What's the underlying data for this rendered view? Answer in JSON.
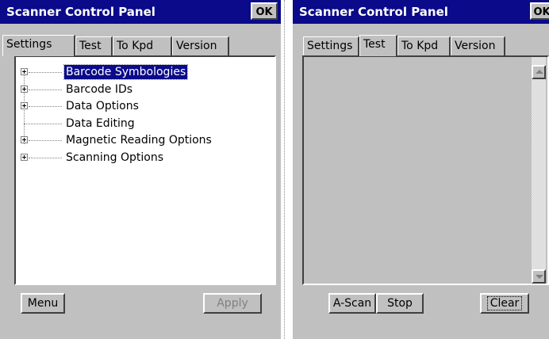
{
  "left": {
    "title": "Scanner Control Panel",
    "ok_label": "OK",
    "tabs": [
      {
        "label": "Settings",
        "active": true
      },
      {
        "label": "Test",
        "active": false
      },
      {
        "label": "To Kpd",
        "active": false
      },
      {
        "label": "Version",
        "active": false
      }
    ],
    "tree": [
      {
        "label": "Barcode Symbologies",
        "expandable": true,
        "selected": true,
        "icon": "expand-plus-icon"
      },
      {
        "label": "Barcode IDs",
        "expandable": true,
        "selected": false,
        "icon": "expand-plus-icon"
      },
      {
        "label": "Data Options",
        "expandable": true,
        "selected": false,
        "icon": "expand-plus-icon"
      },
      {
        "label": "Data Editing",
        "expandable": false,
        "selected": false
      },
      {
        "label": "Magnetic Reading Options",
        "expandable": true,
        "selected": false,
        "icon": "expand-plus-icon"
      },
      {
        "label": "Scanning Options",
        "expandable": true,
        "selected": false,
        "icon": "expand-plus-icon"
      }
    ],
    "menu_label": "Menu",
    "apply_label": "Apply",
    "apply_disabled": true
  },
  "right": {
    "title": "Scanner Control Panel",
    "ok_label": "OK",
    "tabs": [
      {
        "label": "Settings",
        "active": false
      },
      {
        "label": "Test",
        "active": true
      },
      {
        "label": "To Kpd",
        "active": false
      },
      {
        "label": "Version",
        "active": false
      }
    ],
    "scroll_up_icon": "scroll-up-arrow-icon",
    "scroll_down_icon": "scroll-down-arrow-icon",
    "ascan_label": "A-Scan",
    "stop_label": "Stop",
    "clear_label": "Clear"
  },
  "colors": {
    "titlebar": "#0a0a8a",
    "face": "#c0c0c0",
    "selection": "#0a0a8a"
  }
}
